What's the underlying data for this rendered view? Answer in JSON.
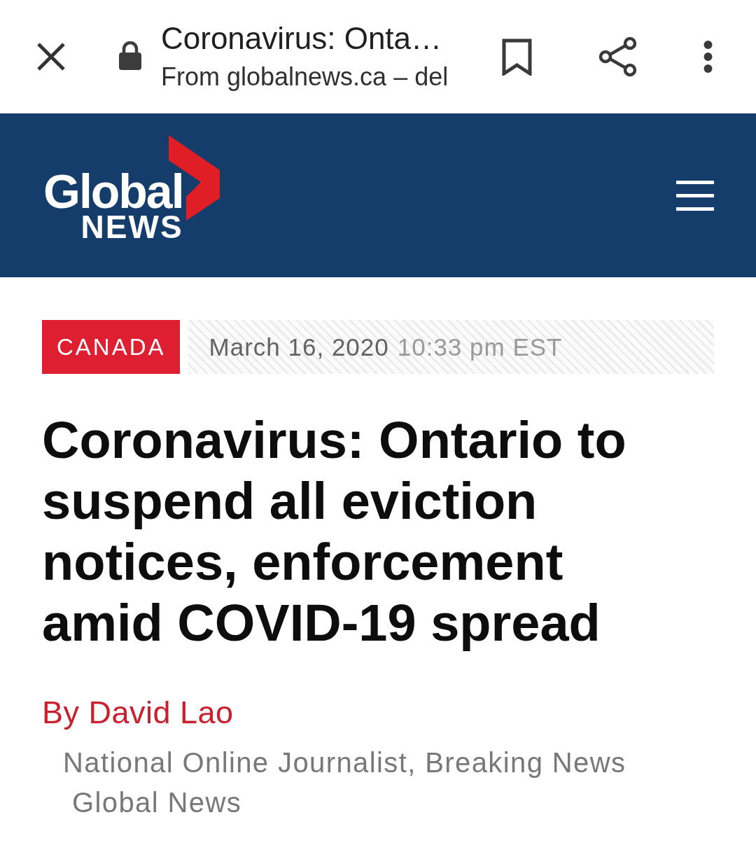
{
  "browser_bar": {
    "title": "Coronavirus: Onta…",
    "subtitle": "From globalnews.ca – del"
  },
  "site_header": {
    "logo": {
      "wordmark": "Global",
      "subline": "NEWS"
    }
  },
  "article": {
    "category": "CANADA",
    "date": "March 16, 2020",
    "time": "10:33 pm EST",
    "headline": "Coronavirus: Ontario to suspend all eviction notices, enforcement amid COVID-19 spread",
    "byline": "By David Lao",
    "author_roles": [
      "National Online Journalist, Breaking News",
      "Global News"
    ]
  }
}
